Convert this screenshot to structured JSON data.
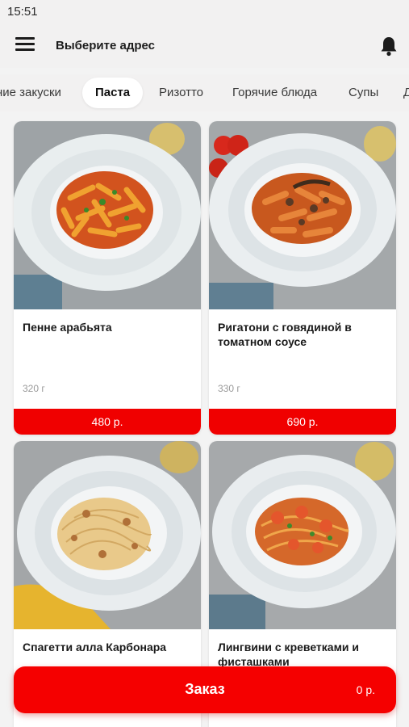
{
  "status": {
    "time": "15:51"
  },
  "header": {
    "title": "Выберите адрес",
    "menu_icon": "hamburger-menu-icon",
    "bell_icon": "bell-icon"
  },
  "tabs": [
    {
      "label": "ние закуски",
      "active": false
    },
    {
      "label": "Паста",
      "active": true
    },
    {
      "label": "Ризотто",
      "active": false
    },
    {
      "label": "Горячие блюда",
      "active": false
    },
    {
      "label": "Супы",
      "active": false
    },
    {
      "label": "Д",
      "active": false
    }
  ],
  "products": [
    {
      "name": "Пенне арабьята",
      "weight": "320 г",
      "price": "480 р."
    },
    {
      "name": "Ригатони с говядиной в томатном соусе",
      "weight": "330 г",
      "price": "690 р."
    },
    {
      "name": "Спагетти алла Карбонара",
      "weight": "",
      "price": ""
    },
    {
      "name": "Лингвини с креветками и фисташками",
      "weight": "",
      "price": ""
    }
  ],
  "order": {
    "label": "Заказ",
    "total": "0 р."
  },
  "colors": {
    "accent": "#f50000",
    "background": "#f3f3f3"
  }
}
